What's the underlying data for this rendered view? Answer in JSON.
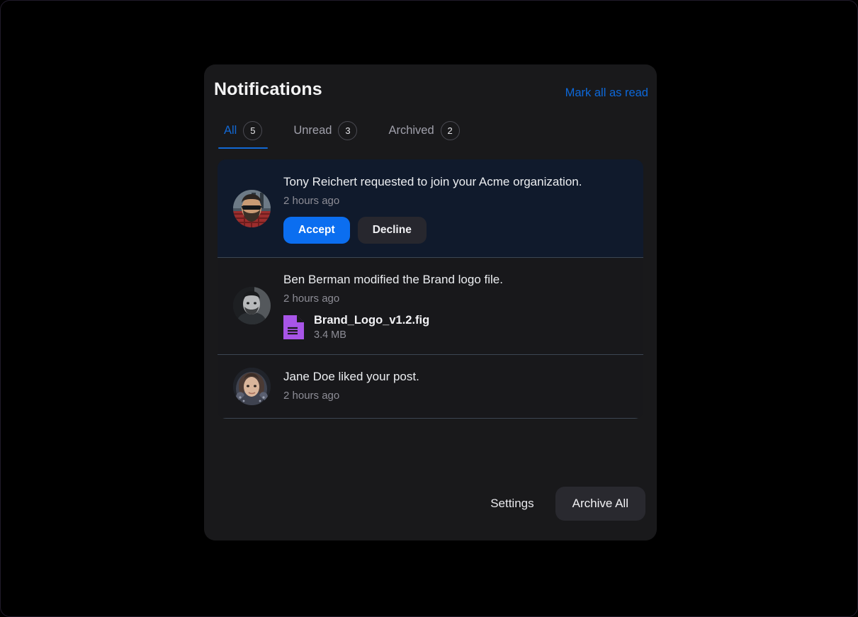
{
  "header": {
    "title": "Notifications",
    "mark_all_label": "Mark all as read"
  },
  "tabs": [
    {
      "label": "All",
      "badge": "5",
      "active": true
    },
    {
      "label": "Unread",
      "badge": "3",
      "active": false
    },
    {
      "label": "Archived",
      "badge": "2",
      "active": false
    }
  ],
  "notifications": [
    {
      "avatar": "avatar-bearded-man-sunglasses",
      "text": "Tony Reichert requested to join your Acme organization.",
      "time": "2 hours ago",
      "unread": true,
      "accept_label": "Accept",
      "decline_label": "Decline"
    },
    {
      "avatar": "avatar-man-portrait-bw",
      "text": "Ben Berman modified the Brand logo file.",
      "time": "2 hours ago",
      "unread": false,
      "file_name": "Brand_Logo_v1.2.fig",
      "file_size": "3.4 MB"
    },
    {
      "avatar": "avatar-woman-scarf",
      "text": "Jane Doe liked your post.",
      "time": "2 hours ago",
      "unread": false
    }
  ],
  "footer": {
    "settings_label": "Settings",
    "archive_all_label": "Archive All"
  },
  "colors": {
    "accent_blue": "#0b6ef0",
    "link_blue": "#0d68d9",
    "tab_active": "#1268d4",
    "file_icon_purple": "#a855e8",
    "card_bg": "#19191b",
    "unread_bg": "#101a2c",
    "page_bg": "#000000"
  }
}
